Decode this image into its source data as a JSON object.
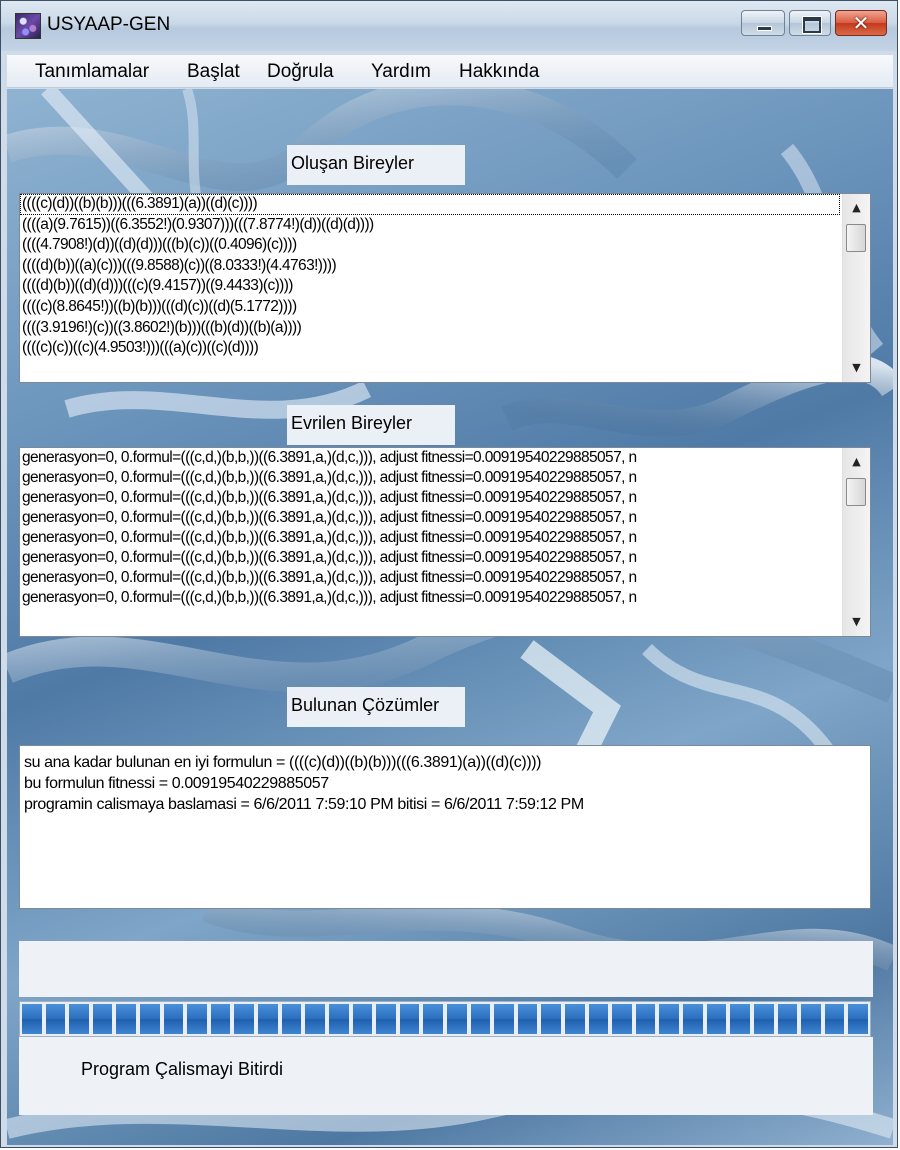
{
  "window": {
    "title": "USYAAP-GEN"
  },
  "menu": {
    "items": [
      "Tanımlamalar",
      "Başlat",
      "Doğrula",
      "Yardım",
      "Hakkında"
    ]
  },
  "sections": {
    "olusan_label": "Oluşan Bireyler",
    "evrilen_label": "Evrilen Bireyler",
    "bulunan_label": "Bulunan Çözümler"
  },
  "olusan_list": [
    "((((c)(d))((b)(b)))(((6.3891)(a))((d)(c))))",
    "((((a)(9.7615))((6.3552!)(0.9307)))(((7.8774!)(d))((d)(d))))",
    "((((4.7908!)(d))((d)(d)))(((b)(c))((0.4096)(c))))",
    "((((d)(b))((a)(c)))(((9.8588)(c))((8.0333!)(4.4763!))))",
    "((((d)(b))((d)(d)))(((c)(9.4157))((9.4433)(c))))",
    "((((c)(8.8645!))((b)(b)))(((d)(c))((d)(5.1772))))",
    "((((3.9196!)(c))((3.8602!)(b)))(((b)(d))((b)(a))))",
    "((((c)(c))((c)(4.9503!)))(((a)(c))((c)(d))))"
  ],
  "evrilen_list": [
    "generasyon=0, 0.formul=(((c,d,)(b,b,))((6.3891,a,)(d,c,))), adjust fitnessi=0.0091954022988505​7, n",
    "generasyon=0, 0.formul=(((c,d,)(b,b,))((6.3891,a,)(d,c,))), adjust fitnessi=0.0091954022988505​7, n",
    "generasyon=0, 0.formul=(((c,d,)(b,b,))((6.3891,a,)(d,c,))), adjust fitnessi=0.0091954022988505​7, n",
    "generasyon=0, 0.formul=(((c,d,)(b,b,))((6.3891,a,)(d,c,))), adjust fitnessi=0.0091954022988505​7, n",
    "generasyon=0, 0.formul=(((c,d,)(b,b,))((6.3891,a,)(d,c,))), adjust fitnessi=0.0091954022988505​7, n",
    "generasyon=0, 0.formul=(((c,d,)(b,b,))((6.3891,a,)(d,c,))), adjust fitnessi=0.0091954022988505​7, n",
    "generasyon=0, 0.formul=(((c,d,)(b,b,))((6.3891,a,)(d,c,))), adjust fitnessi=0.0091954022988505​7, n",
    "generasyon=0, 0.formul=(((c,d,)(b,b,))((6.3891,a,)(d,c,))), adjust fitnessi=0.0091954022988505​7, n"
  ],
  "results": {
    "line1": "su ana kadar bulunan en iyi formulun = ((((c)(d))((b)(b)))(((6.3891)(a))((d)(c))))",
    "line2": "bu formulun fitnessi = 0.0091954022988505​7",
    "line3": "programin calismaya baslamasi = 6/6/2011 7:59:10 PM bitisi = 6/6/2011 7:59:12 PM"
  },
  "progress": {
    "value_fraction": 1.0,
    "segments": 36
  },
  "status": {
    "message": "Program Çalismayi Bitirdi"
  },
  "icons": {
    "app": "app-icon",
    "minimize": "minimize-icon",
    "maximize": "maximize-icon",
    "close": "close-icon",
    "scroll_up": "scroll-up-arrow-icon",
    "scroll_down": "scroll-down-arrow-icon"
  },
  "colors": {
    "progress_fill": "#2a6fbf",
    "close_button": "#c43a1c"
  }
}
